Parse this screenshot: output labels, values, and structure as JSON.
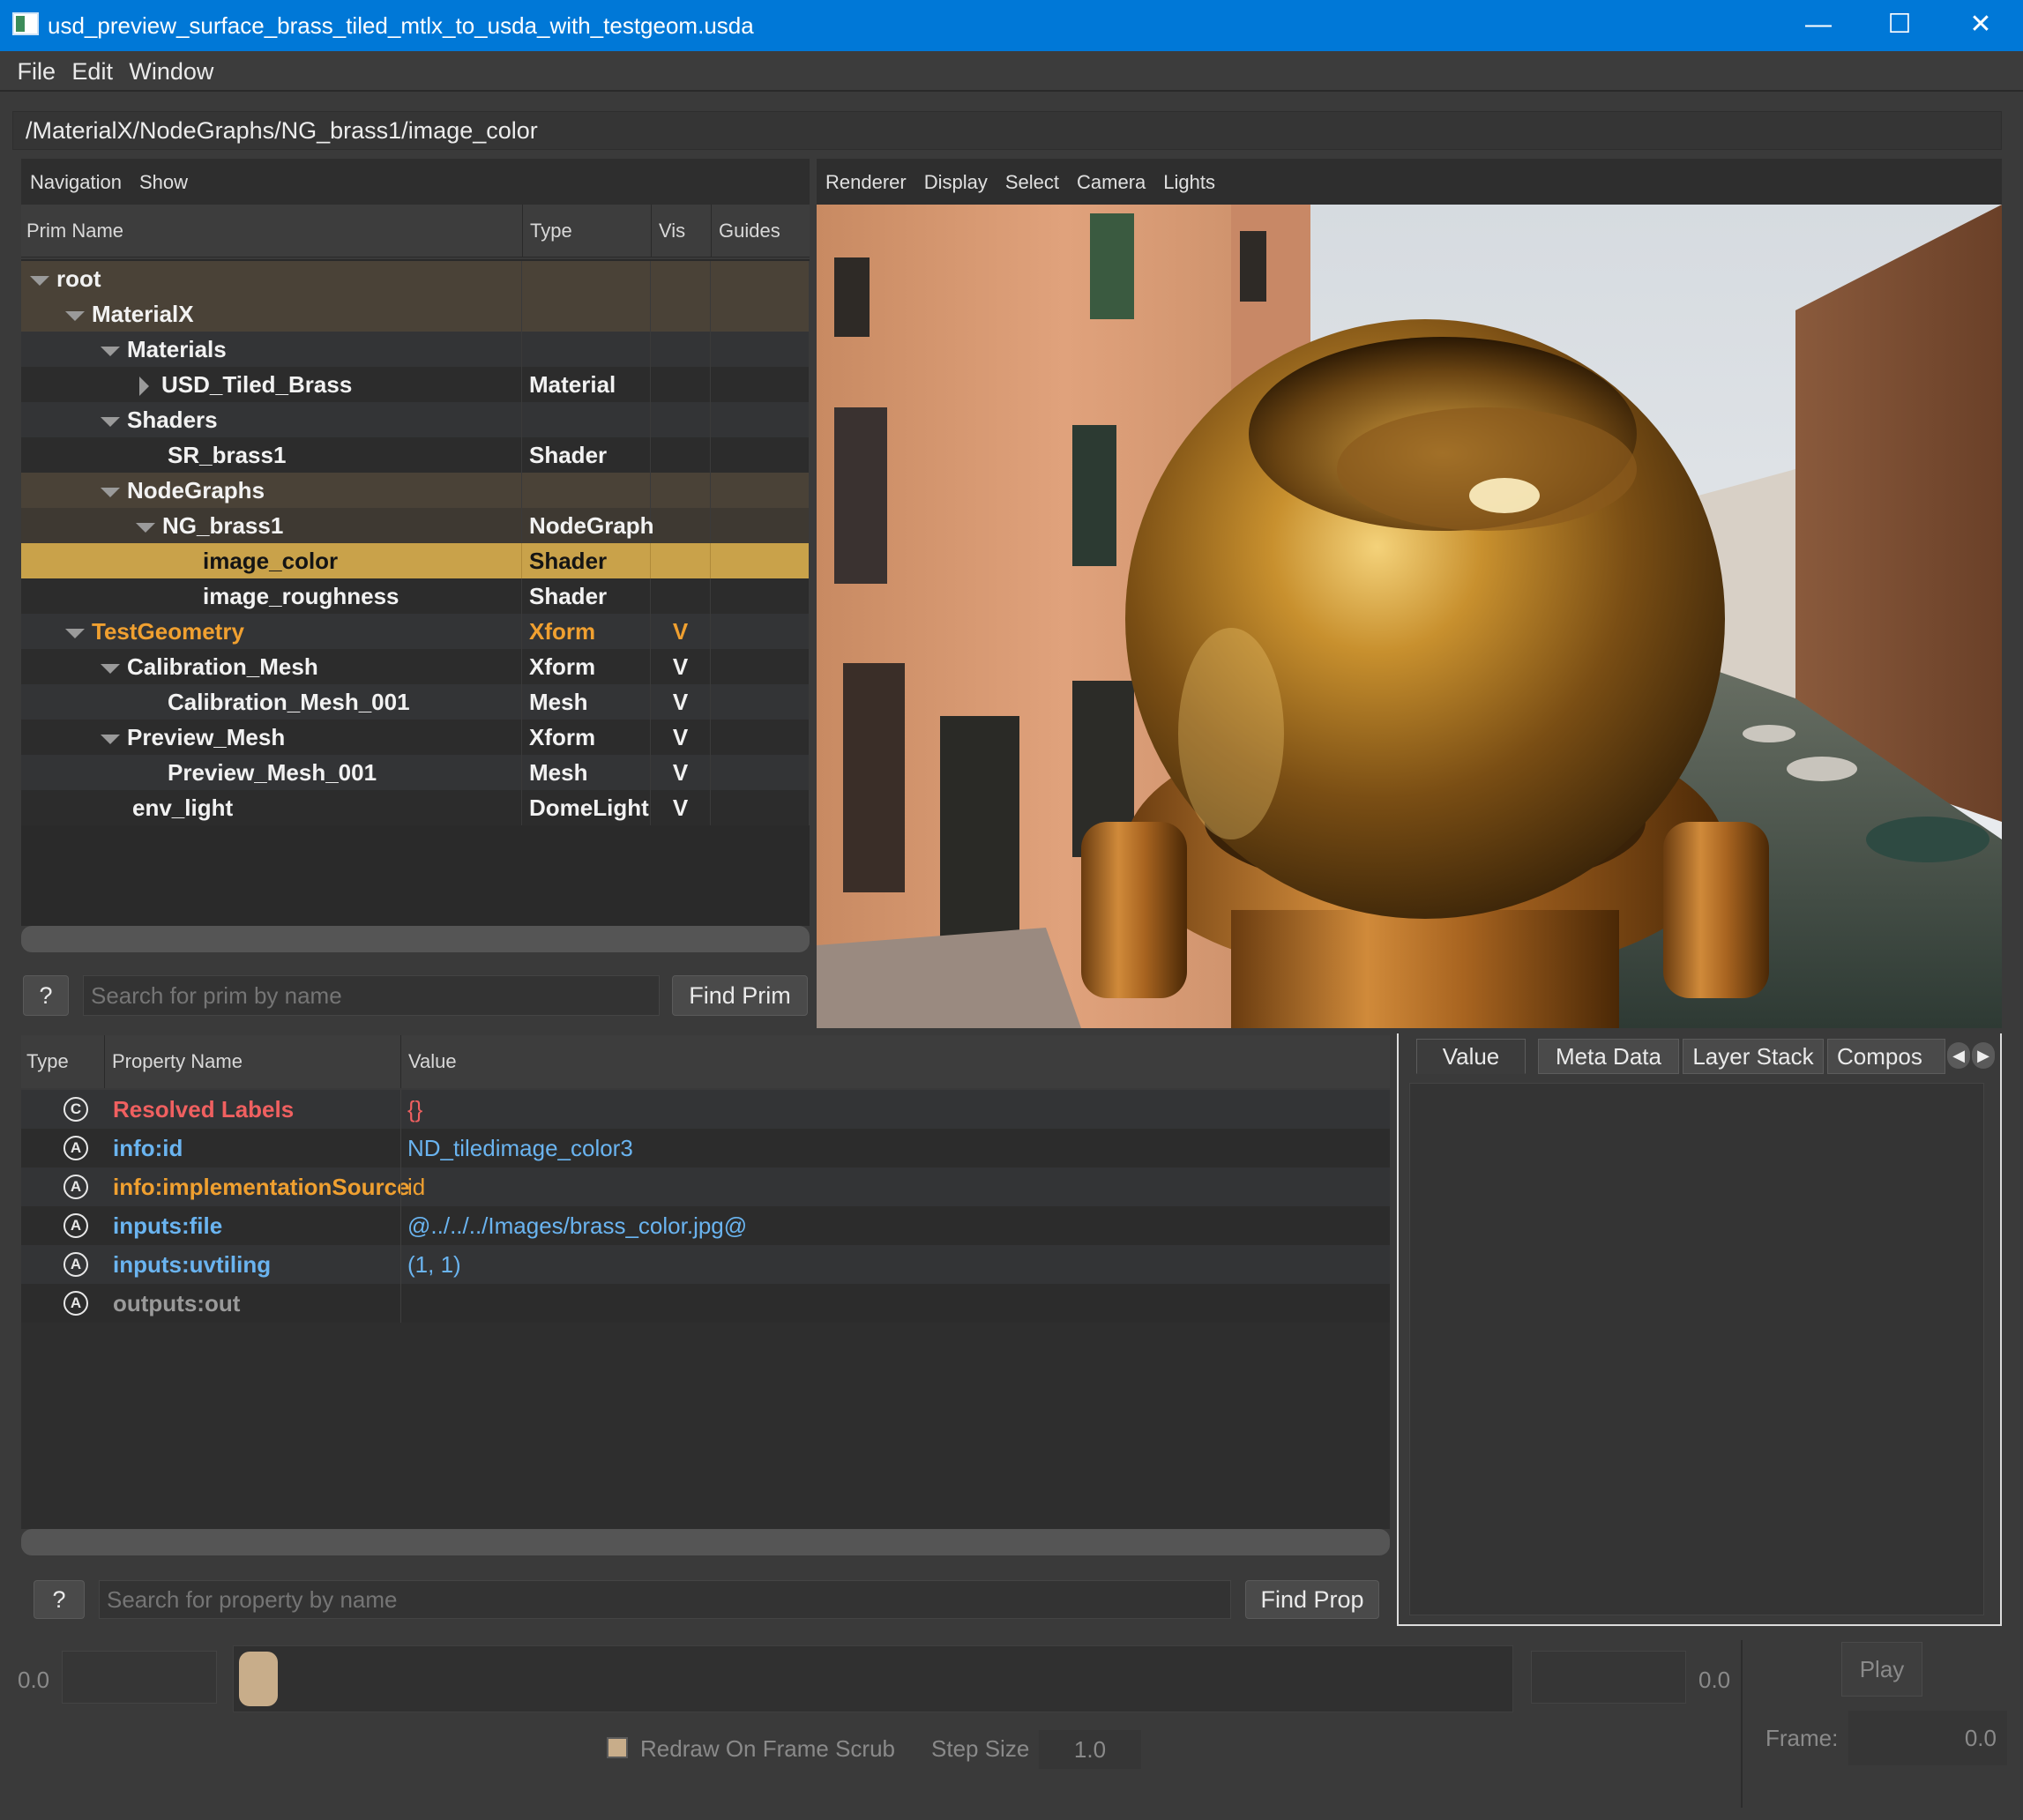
{
  "window": {
    "title": "usd_preview_surface_brass_tiled_mtlx_to_usda_with_testgeom.usda"
  },
  "menu": [
    "File",
    "Edit",
    "Window"
  ],
  "path": "/MaterialX/NodeGraphs/NG_brass1/image_color",
  "browser": {
    "toolbar": [
      "Navigation",
      "Show"
    ],
    "columns": [
      "Prim Name",
      "Type",
      "Vis",
      "Guides"
    ],
    "rows": [
      {
        "name": "root",
        "type": "",
        "vis": ""
      },
      {
        "name": "MaterialX",
        "type": "",
        "vis": ""
      },
      {
        "name": "Materials",
        "type": "",
        "vis": ""
      },
      {
        "name": "USD_Tiled_Brass",
        "type": "Material",
        "vis": ""
      },
      {
        "name": "Shaders",
        "type": "",
        "vis": ""
      },
      {
        "name": "SR_brass1",
        "type": "Shader",
        "vis": ""
      },
      {
        "name": "NodeGraphs",
        "type": "",
        "vis": ""
      },
      {
        "name": "NG_brass1",
        "type": "NodeGraph",
        "vis": ""
      },
      {
        "name": "image_color",
        "type": "Shader",
        "vis": ""
      },
      {
        "name": "image_roughness",
        "type": "Shader",
        "vis": ""
      },
      {
        "name": "TestGeometry",
        "type": "Xform",
        "vis": "V"
      },
      {
        "name": "Calibration_Mesh",
        "type": "Xform",
        "vis": "V"
      },
      {
        "name": "Calibration_Mesh_001",
        "type": "Mesh",
        "vis": "V"
      },
      {
        "name": "Preview_Mesh",
        "type": "Xform",
        "vis": "V"
      },
      {
        "name": "Preview_Mesh_001",
        "type": "Mesh",
        "vis": "V"
      },
      {
        "name": "env_light",
        "type": "DomeLight",
        "vis": "V"
      }
    ],
    "help": "?",
    "search_placeholder": "Search for prim by name",
    "find_label": "Find Prim"
  },
  "viewer": {
    "toolbar": [
      "Renderer",
      "Display",
      "Select",
      "Camera",
      "Lights"
    ]
  },
  "properties": {
    "columns": [
      "Type",
      "Property Name",
      "Value"
    ],
    "rows": [
      {
        "icon": "C",
        "name": "Resolved Labels",
        "value": "{}"
      },
      {
        "icon": "A",
        "name": "info:id",
        "value": "ND_tiledimage_color3"
      },
      {
        "icon": "A",
        "name": "info:implementationSource",
        "value": "id"
      },
      {
        "icon": "A",
        "name": "inputs:file",
        "value": "@../../../Images/brass_color.jpg@"
      },
      {
        "icon": "A",
        "name": "inputs:uvtiling",
        "value": "(1, 1)"
      },
      {
        "icon": "A",
        "name": "outputs:out",
        "value": ""
      }
    ],
    "help": "?",
    "search_placeholder": "Search for property by name",
    "find_label": "Find Prop"
  },
  "inspector": {
    "tabs": [
      "Value",
      "Meta Data",
      "Layer Stack",
      "Compos"
    ]
  },
  "timeline": {
    "start": "0.0",
    "end": "0.0",
    "play": "Play",
    "redraw_label": "Redraw On Frame Scrub",
    "step_label": "Step Size",
    "step_value": "1.0",
    "frame_label": "Frame:",
    "frame_value": "0.0"
  },
  "colors": {
    "selection": "#c9a24a",
    "accent_orange": "#f0a030",
    "value_blue": "#6ab4f0",
    "label_red": "#f06060"
  }
}
